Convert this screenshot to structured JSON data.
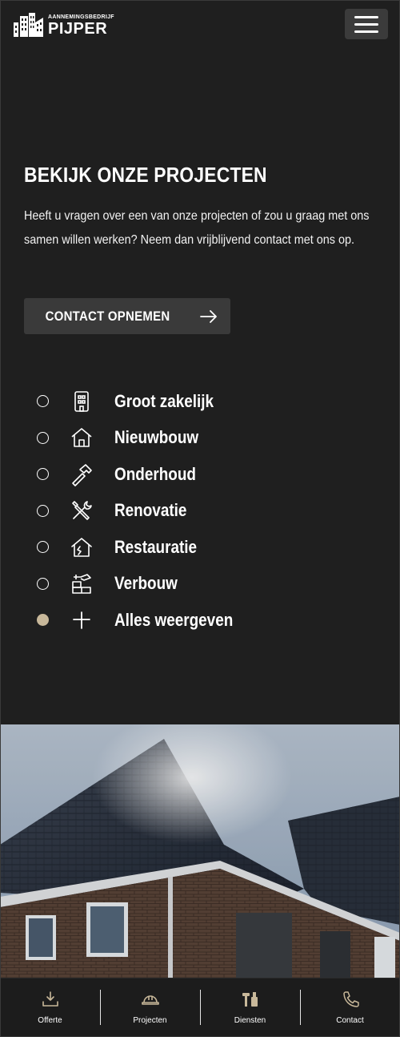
{
  "header": {
    "logo_small": "AANNEMINGSBEDRIJF",
    "logo_main": "PIJPER"
  },
  "hero": {
    "title": "BEKIJK ONZE PROJECTEN",
    "text": "Heeft u vragen over een van onze projecten of zou u graag met ons samen willen werken? Neem dan vrijblijvend contact met ons op.",
    "cta_label": "CONTACT OPNEMEN"
  },
  "filters": [
    {
      "label": "Groot zakelijk",
      "icon": "building-icon",
      "selected": false
    },
    {
      "label": "Nieuwbouw",
      "icon": "house-icon",
      "selected": false
    },
    {
      "label": "Onderhoud",
      "icon": "hammer-icon",
      "selected": false
    },
    {
      "label": "Renovatie",
      "icon": "tools-icon",
      "selected": false
    },
    {
      "label": "Restauratie",
      "icon": "house-restore-icon",
      "selected": false
    },
    {
      "label": "Verbouw",
      "icon": "bricks-trowel-icon",
      "selected": false
    },
    {
      "label": "Alles weergeven",
      "icon": "plus-icon",
      "selected": true
    }
  ],
  "bottom_nav": [
    {
      "label": "Offerte",
      "icon": "download-tray-icon"
    },
    {
      "label": "Projecten",
      "icon": "hard-hat-icon"
    },
    {
      "label": "Diensten",
      "icon": "hammer-brush-icon"
    },
    {
      "label": "Contact",
      "icon": "phone-icon"
    }
  ],
  "colors": {
    "background": "#1f1f1f",
    "button": "#3a3a3a",
    "accent": "#c8b89a"
  }
}
